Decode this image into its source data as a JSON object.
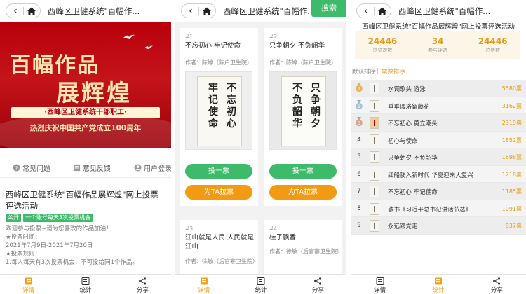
{
  "common": {
    "page_title": "西峰区卫健系统\"百幅作...",
    "tabs": [
      "详情",
      "统计",
      "分享"
    ],
    "accent_green": "#3dbb6a",
    "accent_orange": "#f29b12"
  },
  "screen1": {
    "banner": {
      "line1": "百幅作品",
      "line2": "展辉煌",
      "org": "·西峰区卫健系统干部职工·",
      "slogan": "热烈庆祝中国共产党成立100周年"
    },
    "links": [
      {
        "label": "常见问题",
        "icon": "question-icon"
      },
      {
        "label": "意见反馈",
        "icon": "feedback-icon"
      },
      {
        "label": "用户登录",
        "icon": "user-icon"
      }
    ],
    "info": {
      "title": "西峰区卫健系统\"百幅作品展辉煌\"网上投票评选活动",
      "tags": [
        "公开",
        "一个账号每天3次投票机会"
      ],
      "lines": [
        "欢迎参与投票~请为您喜欢的作品加油！",
        "★投票时间：",
        "2021年7月9日-2021年7月20日",
        "★投票规则：",
        "1.每人每天有3次投票机会，不可投给同1个作品。"
      ]
    },
    "active_tab": 0
  },
  "screen2": {
    "search_label": "搜索",
    "vote_label": "投一票",
    "cheer_label": "为TA拉票",
    "cards": [
      {
        "num": "#1",
        "name": "不忘初心 牢记使命",
        "author": "作者：陈婷（陈户卫生院）",
        "chars": [
          "不忘初心",
          "牢记使命"
        ]
      },
      {
        "num": "#2",
        "name": "只争朝夕 不负韶华",
        "author": "作者：陈婷（陈户卫生院）",
        "chars": [
          "只争朝夕",
          "不负韶华"
        ]
      },
      {
        "num": "#3",
        "name": "江山就是人民 人民就是江山",
        "author": "作者：徐敏（后官寨卫生院）"
      },
      {
        "num": "#4",
        "name": "桂子飘香",
        "author": "作者：徐敏（后官寨卫生院）"
      }
    ],
    "active_tab": 0
  },
  "screen3": {
    "title": "西峰区卫健系统\"百幅作品展辉煌\"网上投票评选活动",
    "stats": [
      {
        "value": "24446",
        "label": "浏览次数"
      },
      {
        "value": "34",
        "label": "参与评选"
      },
      {
        "value": "24446",
        "label": "总票数"
      }
    ],
    "sort_default": "默认排序",
    "sort_votes": "票数排序",
    "ranking": [
      {
        "rank": "1",
        "name": "水调歌头 游泳",
        "count": "5580票"
      },
      {
        "rank": "2",
        "name": "垂垂璎珞絮藤花",
        "count": "3162票"
      },
      {
        "rank": "3",
        "name": "不忘初心 勇立潮头",
        "count": "2319票"
      },
      {
        "rank": "4",
        "name": "初心与使命",
        "count": "1852票"
      },
      {
        "rank": "5",
        "name": "只争朝夕 不负韶华",
        "count": "1698票"
      },
      {
        "rank": "6",
        "name": "红船驶入新时代 华夏迎来大复兴",
        "count": "1218票"
      },
      {
        "rank": "7",
        "name": "不忘初心 牢记使命",
        "count": "1185票"
      },
      {
        "rank": "8",
        "name": "敬书《习近平总书记讲话节选》",
        "count": "1091票"
      },
      {
        "rank": "9",
        "name": "永远跟党走",
        "count": "837票"
      }
    ],
    "active_tab": 1
  }
}
